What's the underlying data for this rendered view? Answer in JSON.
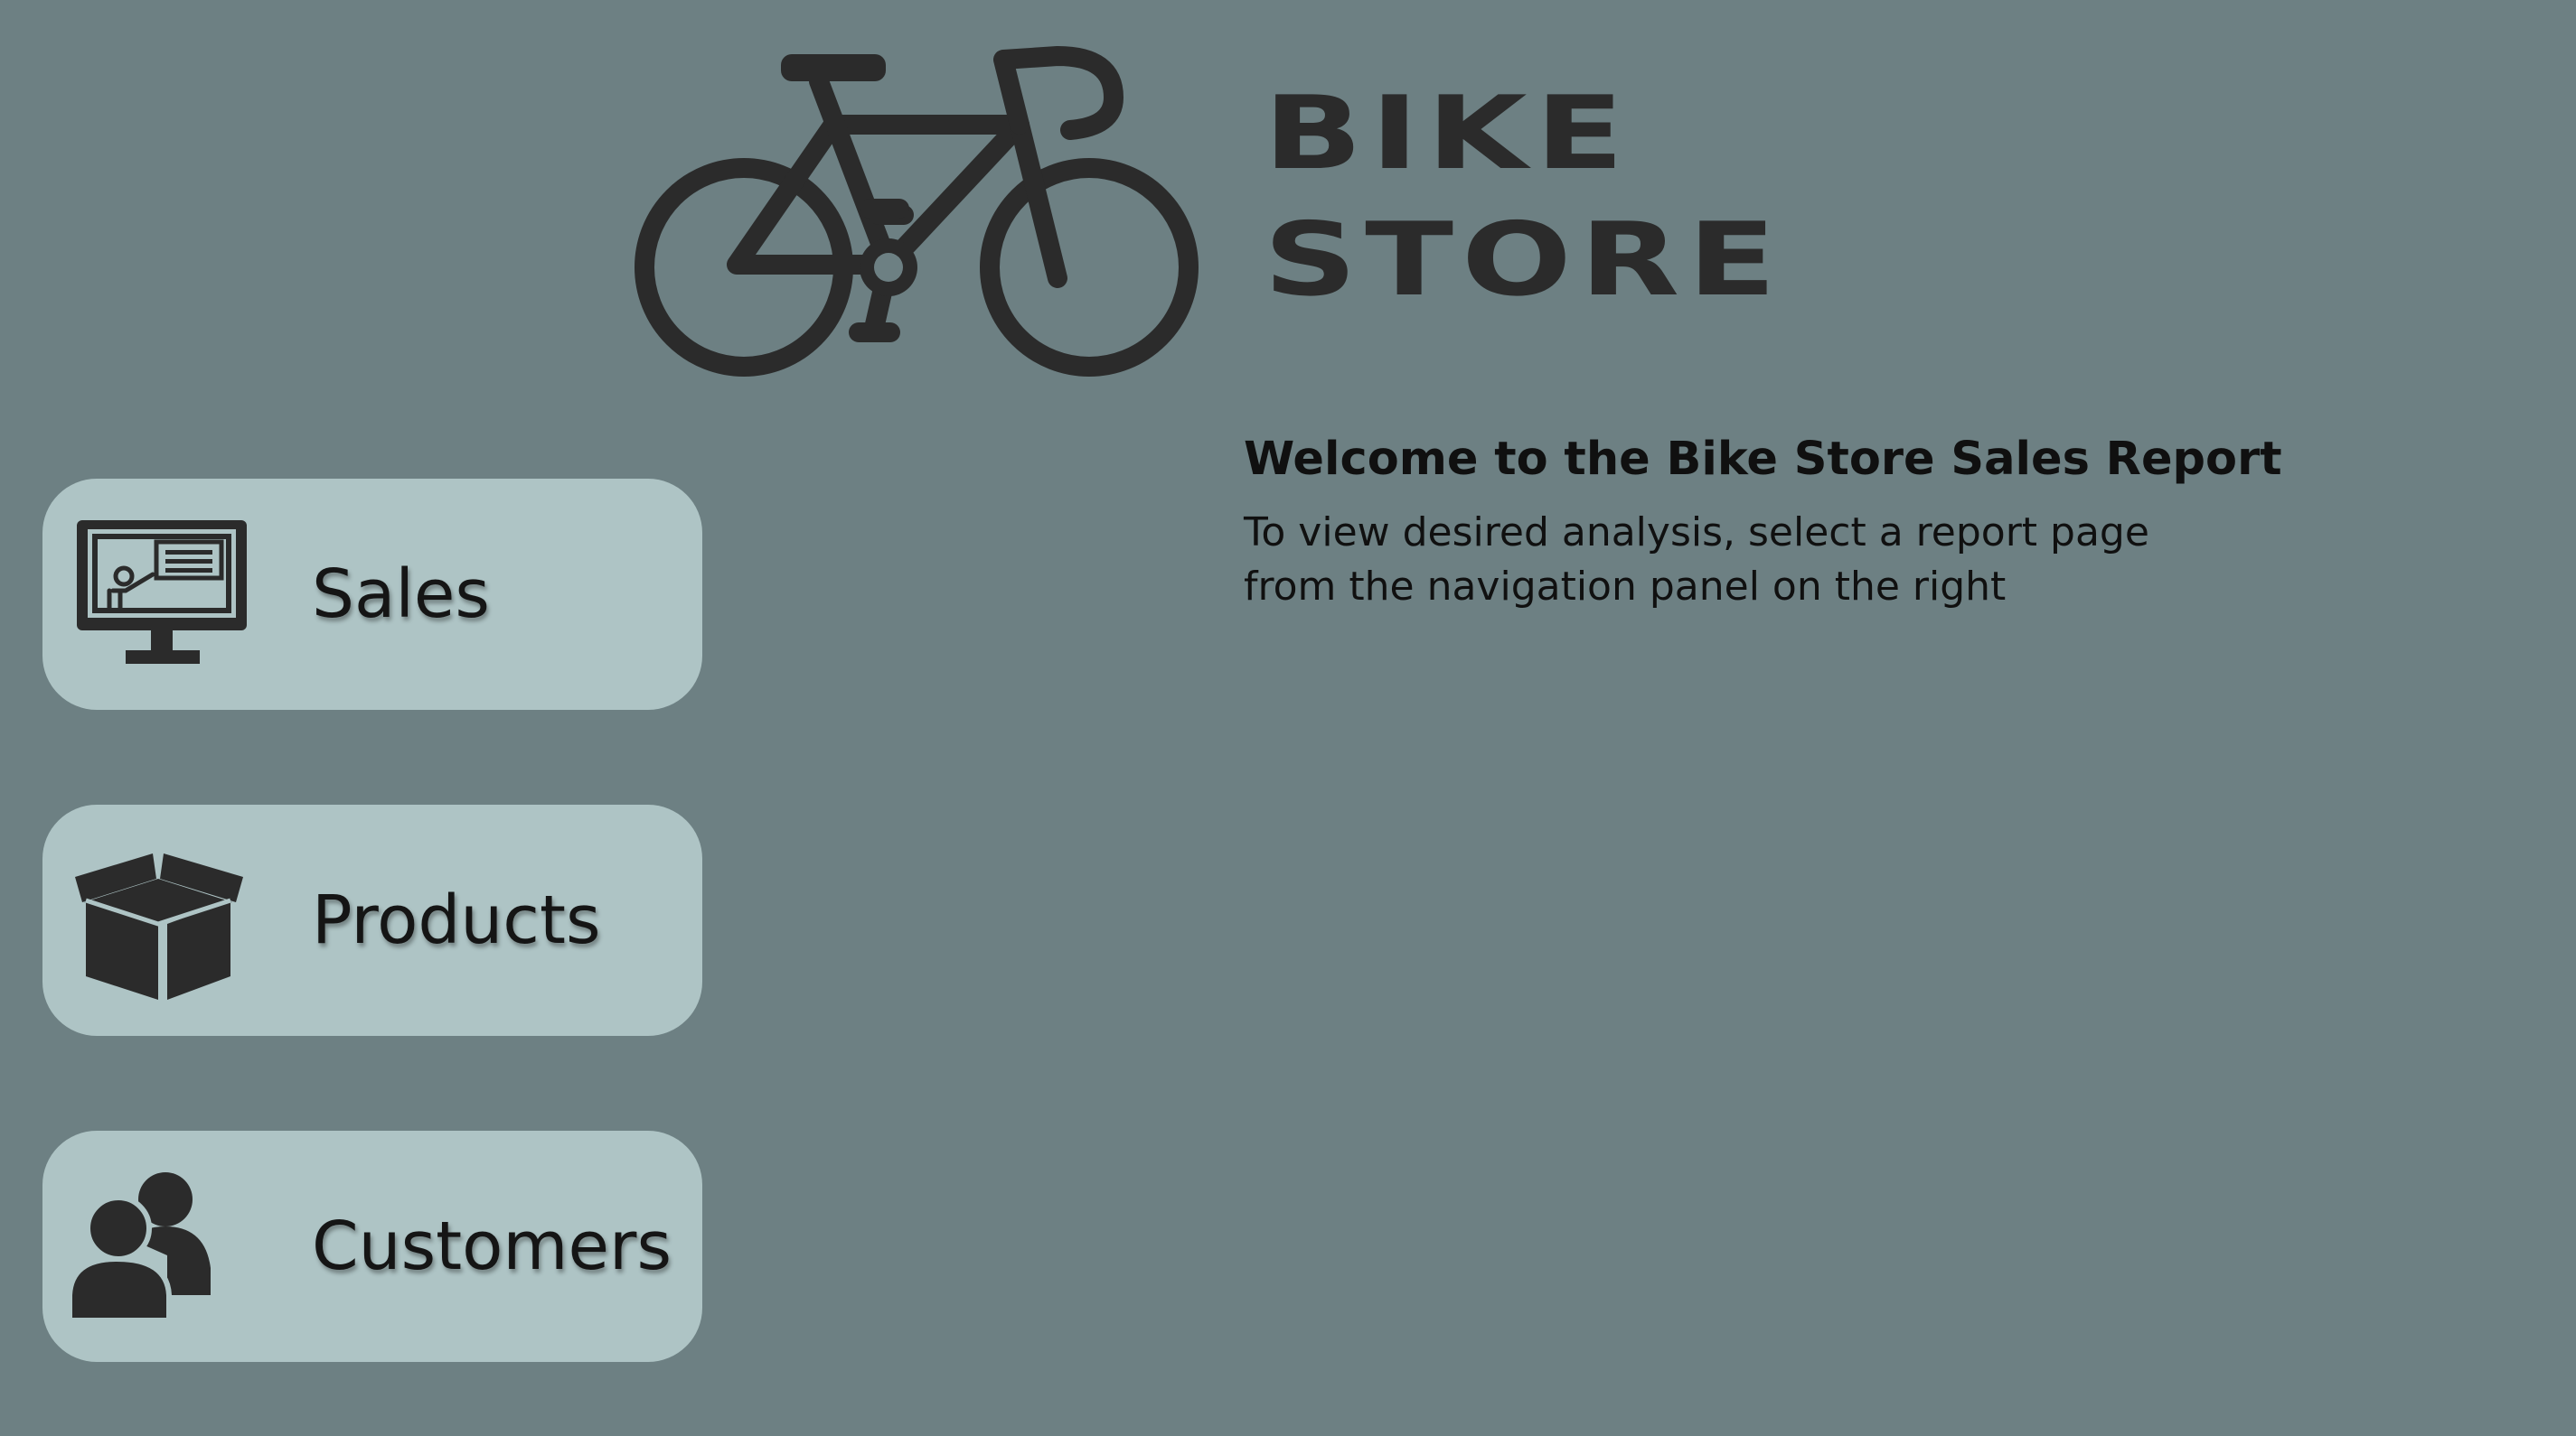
{
  "colors": {
    "background": "#6d8083",
    "nav_button": "#aec4c5",
    "icon": "#2b2b2b",
    "text": "#101010"
  },
  "header": {
    "logo_icon": "bicycle-icon",
    "logo_line_1": "BIKE",
    "logo_line_2": "STORE"
  },
  "welcome": {
    "title": "Welcome to the Bike Store Sales Report",
    "body": "To view desired analysis, select a report page from the navigation panel on the right"
  },
  "nav": {
    "items": [
      {
        "label": "Sales",
        "icon": "presentation-monitor-icon"
      },
      {
        "label": "Products",
        "icon": "open-box-icon"
      },
      {
        "label": "Customers",
        "icon": "users-icon"
      }
    ]
  }
}
